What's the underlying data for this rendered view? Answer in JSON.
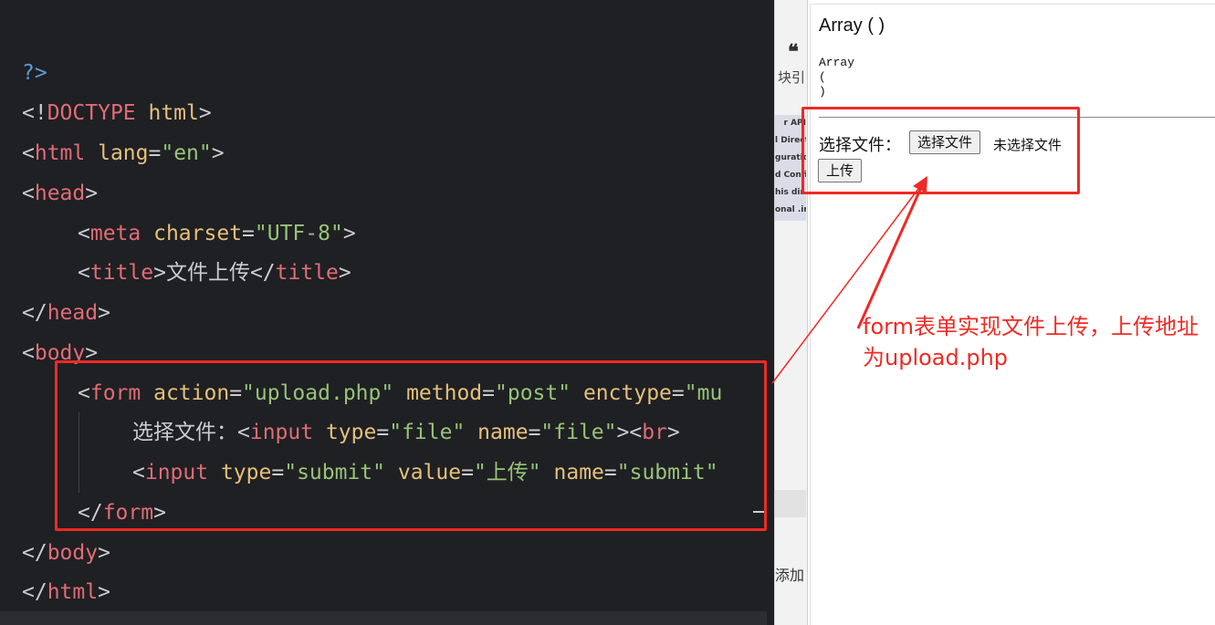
{
  "editor": {
    "lines": [
      {
        "p": "?>"
      },
      {
        "open": "<!",
        "tag": "DOCTYPE",
        "attr": " html",
        "close": ">"
      },
      {
        "open": "<",
        "tag": "html",
        "attr": " lang",
        "eq": "=",
        "str": "\"en\"",
        "close": ">"
      },
      {
        "open": "<",
        "tag": "head",
        "close": ">"
      },
      {
        "open": "<",
        "tag": "meta",
        "attr": " charset",
        "eq": "=",
        "str": "\"UTF-8\"",
        "close": ">"
      },
      {
        "open": "<",
        "tag": "title",
        "mid": ">文件上传</",
        "tag2": "title",
        "close": ">"
      },
      {
        "open": "</",
        "tag": "head",
        "close": ">"
      },
      {
        "open": "<",
        "tag": "body",
        "close": ">"
      },
      {
        "open": "<",
        "tag": "form",
        "a1": " action",
        "e1": "=",
        "s1": "\"upload.php\"",
        "a2": " method",
        "e2": "=",
        "s2": "\"post\"",
        "a3": " enctype",
        "e3": "=",
        "s3": "\"mu"
      },
      {
        "text": "选择文件：",
        "open": "<",
        "tag": "input",
        "a1": " type",
        "e1": "=",
        "s1": "\"file\"",
        "a2": " name",
        "e2": "=",
        "s2": "\"file\"",
        "mid": "><",
        "tag2": "br",
        "close": ">"
      },
      {
        "open": "<",
        "tag": "input",
        "a1": " type",
        "e1": "=",
        "s1": "\"submit\"",
        "a2": " value",
        "e2": "=",
        "s2": "\"上传\"",
        "a3": " name",
        "e3": "=",
        "s3": "\"submit\""
      },
      {
        "open": "</",
        "tag": "form",
        "close": ">"
      },
      {
        "open": "</",
        "tag": "body",
        "close": ">"
      },
      {
        "open": "</",
        "tag": "html",
        "close": ">"
      }
    ]
  },
  "side_panel": {
    "quote_icon": "quote-icon",
    "label_top": "块引",
    "list_items": [
      "r API",
      "l Directi",
      "guration",
      "d Confi",
      "his dir f",
      "onal .in"
    ],
    "label_bottom": "添加"
  },
  "browser": {
    "title": "Array ( )",
    "pre_output": "Array\n(\n)",
    "file_label": "选择文件：",
    "file_button": "选择文件",
    "file_status": "未选择文件",
    "submit_button": "上传"
  },
  "annotation": {
    "note": "form表单实现文件上传，上传地址为upload.php",
    "color": "#ee2a24"
  }
}
